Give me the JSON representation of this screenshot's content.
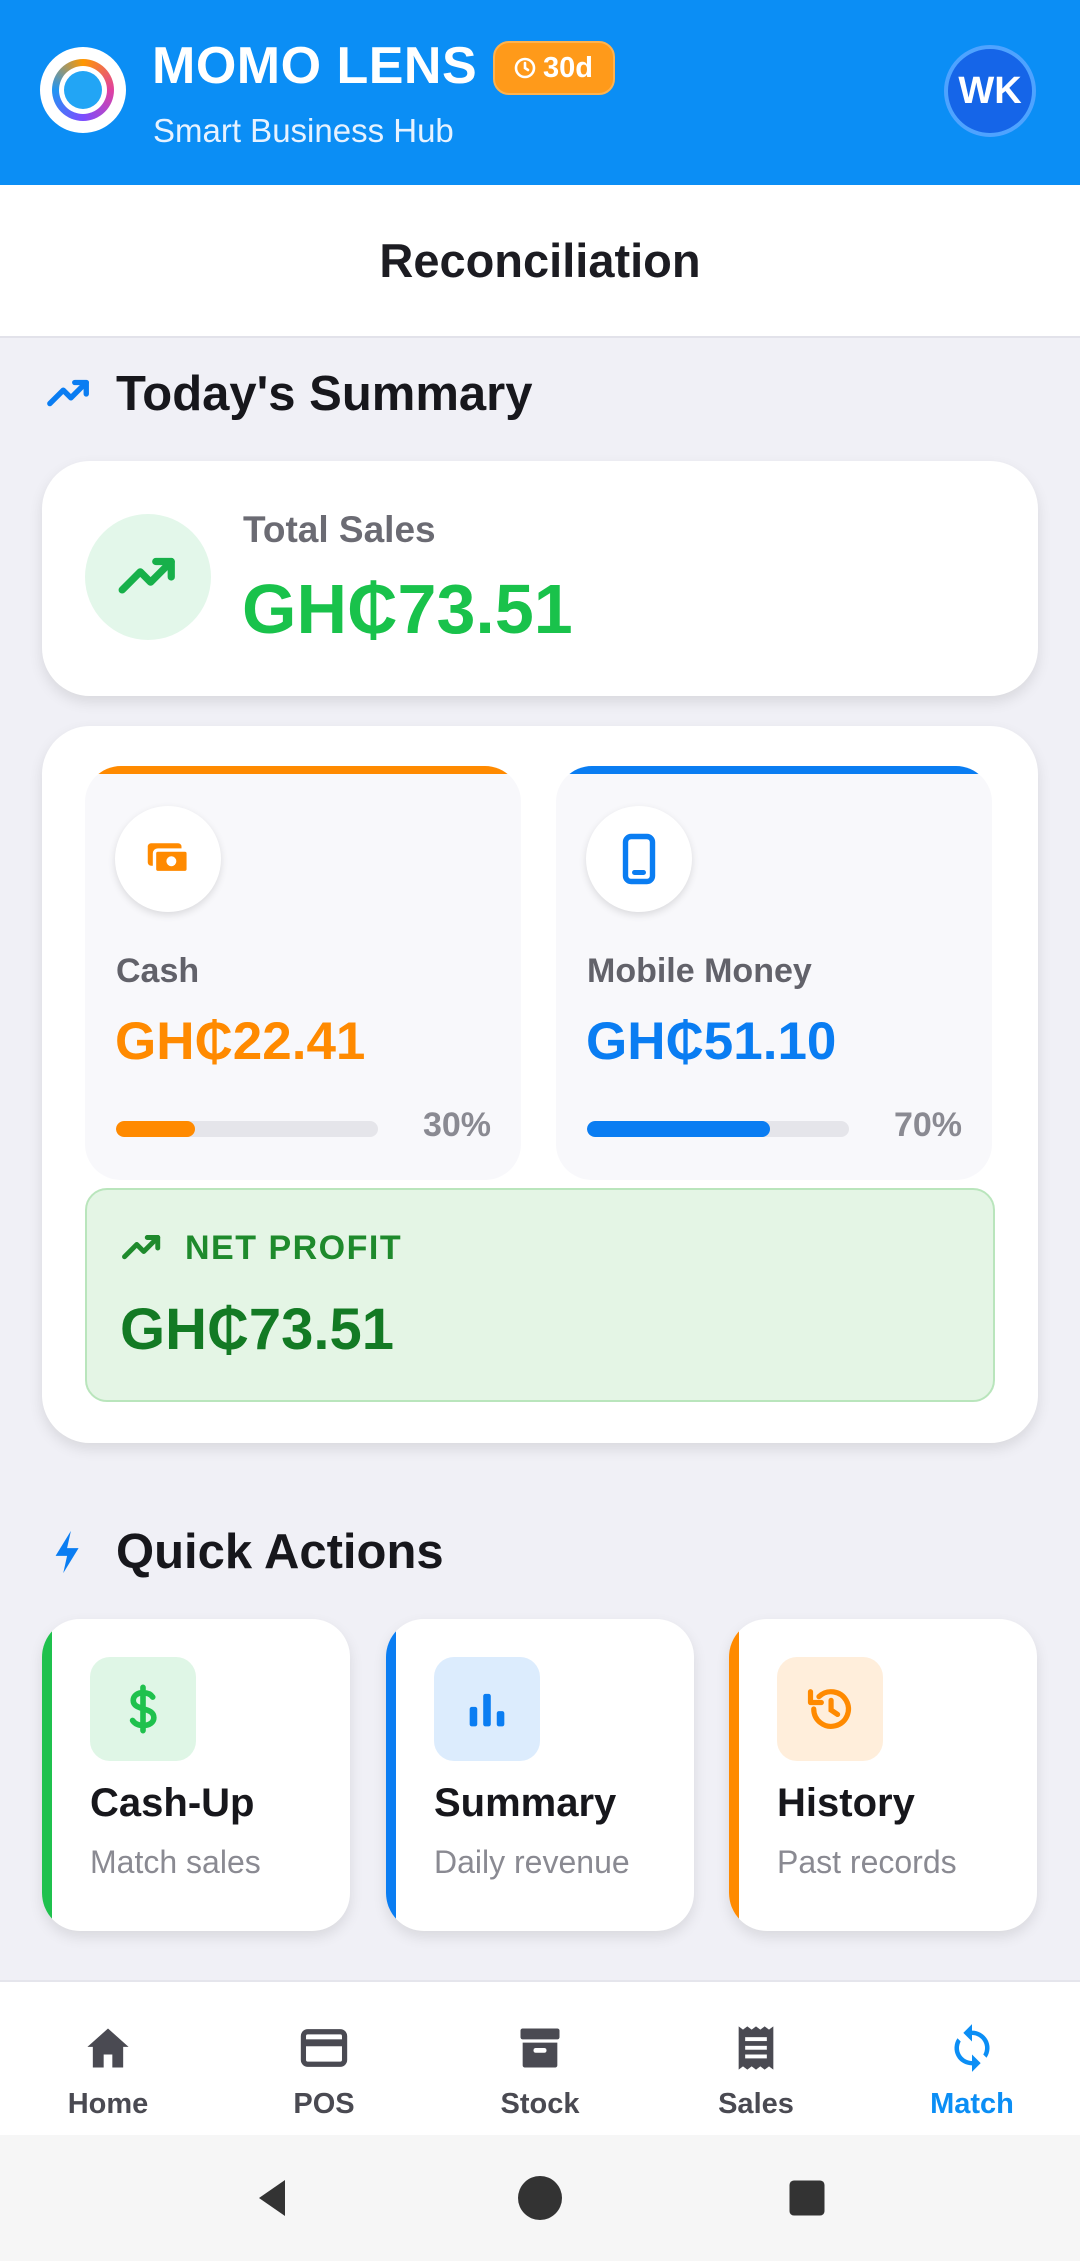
{
  "header": {
    "app_name": "MOMO LENS",
    "tagline": "Smart Business Hub",
    "trial_badge": "30d",
    "avatar_initials": "WK",
    "brand_color": "#0b8ef5"
  },
  "page": {
    "title": "Reconciliation"
  },
  "summary": {
    "heading": "Today's Summary",
    "total_sales_label": "Total Sales",
    "total_sales_value": "GH₵73.51",
    "cash": {
      "label": "Cash",
      "value": "GH₵22.41",
      "percent_label": "30%",
      "share": 0.3,
      "color": "#ff8a00"
    },
    "mobile_money": {
      "label": "Mobile Money",
      "value": "GH₵51.10",
      "percent_label": "70%",
      "share": 0.7,
      "color": "#0a7df2"
    },
    "net_profit_label": "NET PROFIT",
    "net_profit_value": "GH₵73.51"
  },
  "quick_actions": {
    "heading": "Quick Actions",
    "items": [
      {
        "title": "Cash-Up",
        "subtitle": "Match sales",
        "icon": "dollar-icon",
        "color": "#1fc14d"
      },
      {
        "title": "Summary",
        "subtitle": "Daily revenue",
        "icon": "bar-chart-icon",
        "color": "#0a7df2"
      },
      {
        "title": "History",
        "subtitle": "Past records",
        "icon": "history-icon",
        "color": "#ff8a00"
      }
    ]
  },
  "bottom_nav": {
    "items": [
      {
        "label": "Home",
        "icon": "home-icon"
      },
      {
        "label": "POS",
        "icon": "card-icon"
      },
      {
        "label": "Stock",
        "icon": "archive-icon"
      },
      {
        "label": "Sales",
        "icon": "receipt-icon"
      },
      {
        "label": "Match",
        "icon": "sync-icon"
      }
    ],
    "active": "Match"
  }
}
